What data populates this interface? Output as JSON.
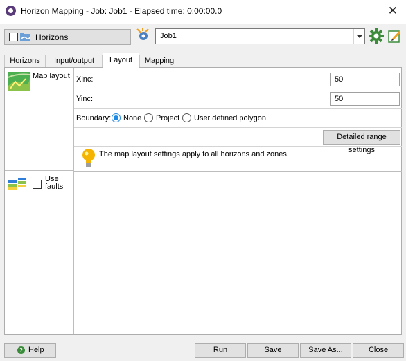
{
  "window": {
    "title": "Horizon Mapping - Job: Job1 - Elapsed time: 0:00:00.0",
    "close_glyph": "✕"
  },
  "toolbar": {
    "horizons_label": "Horizons",
    "job_value": "Job1"
  },
  "tabs": [
    {
      "label": "Horizons"
    },
    {
      "label": "Input/output"
    },
    {
      "label": "Layout"
    },
    {
      "label": "Mapping"
    }
  ],
  "active_tab": "Layout",
  "layout": {
    "map_layout_label": "Map layout",
    "xinc_label": "Xinc:",
    "xinc_value": "50",
    "yinc_label": "Yinc:",
    "yinc_value": "50",
    "boundary_label": "Boundary:",
    "boundary_options": [
      "None",
      "Project",
      "User defined polygon"
    ],
    "boundary_selected": "None",
    "detailed_range_button": "Detailed range settings",
    "info_text": "The map layout settings apply to all horizons and zones.",
    "use_faults_line1": "Use",
    "use_faults_line2": "faults"
  },
  "footer": {
    "help": "Help",
    "run": "Run",
    "save": "Save",
    "save_as": "Save As...",
    "close": "Close"
  },
  "icons": {
    "app": "horizon-mapping-app-icon",
    "horizons": "horizons-folder-icon",
    "job": "job-gear-icon",
    "settings": "settings-gear-icon",
    "edit": "edit-icon",
    "map_layout": "map-layout-icon",
    "faults": "faults-icon",
    "info": "lightbulb-icon",
    "help": "help-icon"
  },
  "colors": {
    "accent": "#1e88e5",
    "gear_green": "#3c8c3c",
    "gear_orange": "#f0a020",
    "bulb": "#f4b400",
    "help_green": "#3a8b3a"
  }
}
